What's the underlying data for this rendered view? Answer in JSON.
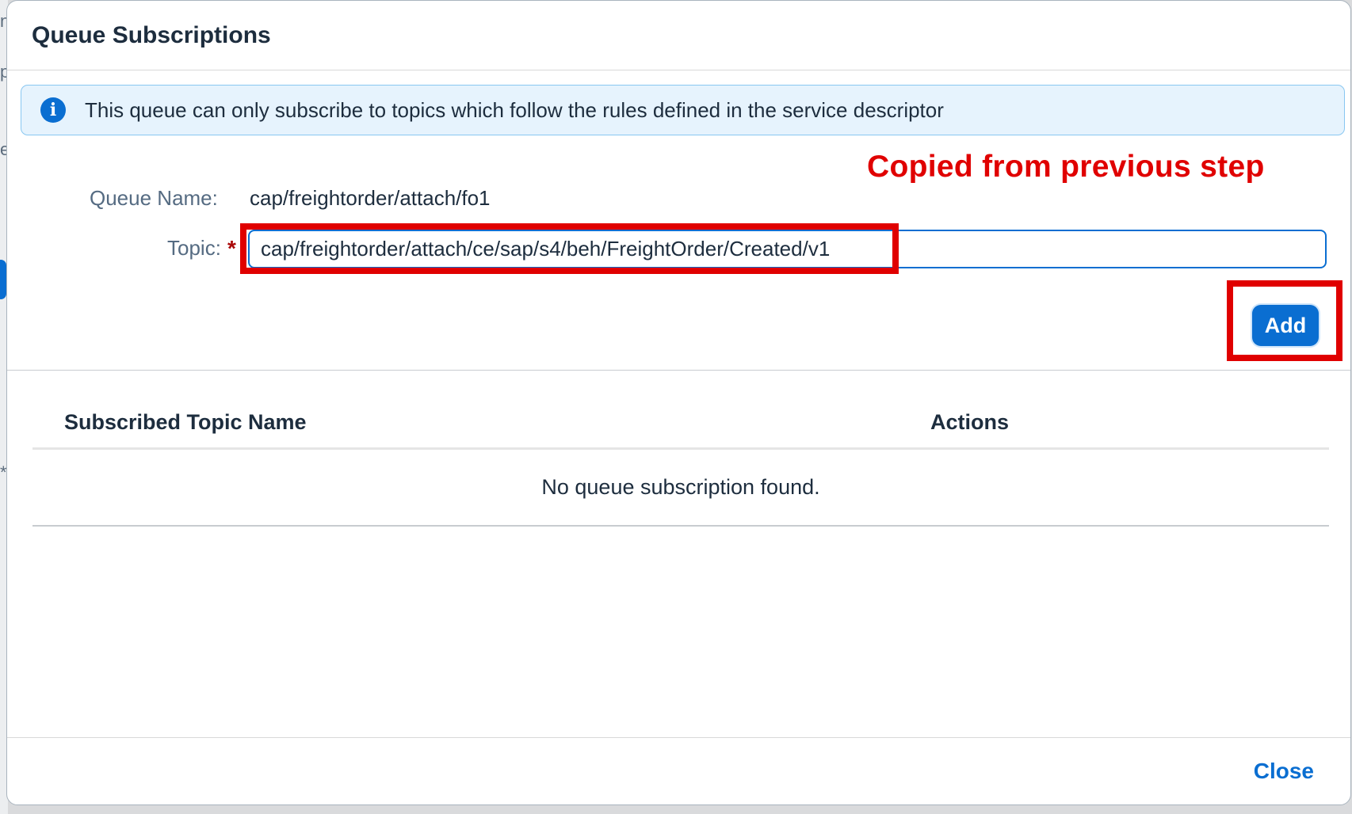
{
  "dialog": {
    "title": "Queue Subscriptions",
    "info_message": "This queue can only subscribe to topics which follow the rules defined in the service descriptor",
    "annotation": "Copied from previous step",
    "form": {
      "queue_name_label": "Queue Name:",
      "queue_name_value": "cap/freightorder/attach/fo1",
      "topic_label": "Topic:",
      "required_marker": "*",
      "topic_value": "cap/freightorder/attach/ce/sap/s4/beh/FreightOrder/Created/v1",
      "add_label": "Add"
    },
    "table": {
      "columns": [
        "Subscribed Topic Name",
        "Actions"
      ],
      "empty_text": "No queue subscription found."
    },
    "footer": {
      "close_label": "Close"
    }
  },
  "background": {
    "fragments": [
      "n",
      "p",
      "e",
      "*"
    ]
  },
  "colors": {
    "accent": "#0a6ed1",
    "annotation_red": "#e00000",
    "info_background": "#e6f3fd",
    "required_star": "#aa0808"
  },
  "icons": {
    "info": "information-circle-icon"
  }
}
